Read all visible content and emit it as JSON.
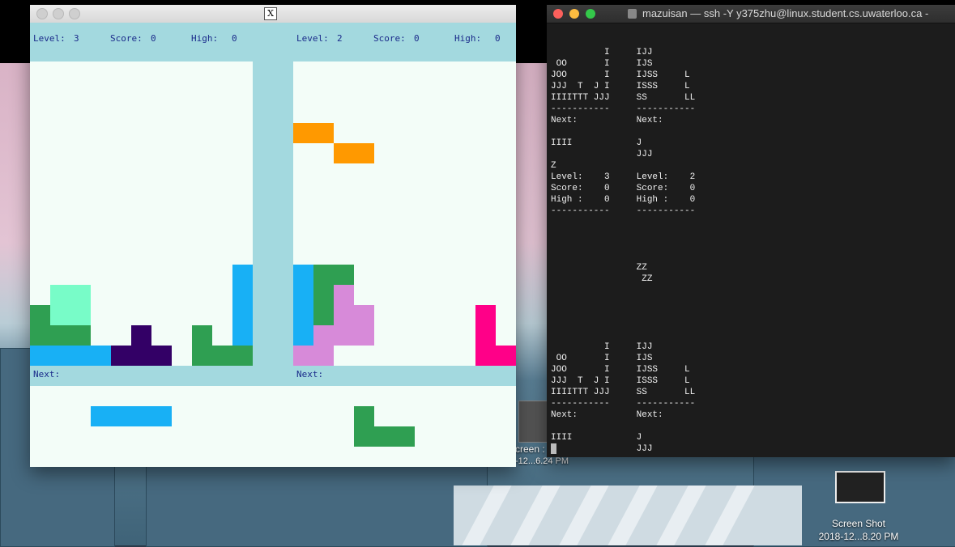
{
  "xwindow": {
    "title_icon": "X",
    "players": [
      {
        "level_label": "Level:",
        "level": "3",
        "score_label": "Score:",
        "score": "0",
        "high_label": "High:",
        "high": "0",
        "next_label": "Next:"
      },
      {
        "level_label": "Level:",
        "level": "2",
        "score_label": "Score:",
        "score": "0",
        "high_label": "High:",
        "high": "0",
        "next_label": "Next:"
      }
    ]
  },
  "terminal": {
    "title": "mazuisan — ssh -Y y375zhu@linux.student.cs.uwaterloo.ca -",
    "lines": [
      "          I     IJJ",
      " OO       I     IJS",
      "JOO       I     IJSS     L",
      "JJJ  T  J I     ISSS     L",
      "IIIITTT JJJ     SS       LL",
      "-----------     -----------",
      "Next:           Next:",
      "",
      "IIII            J",
      "                JJJ",
      "Z",
      "Level:    3     Level:    2",
      "Score:    0     Score:    0",
      "High :    0     High :    0",
      "-----------     -----------",
      "",
      "",
      "",
      "",
      "                ZZ",
      "                 ZZ",
      "",
      "",
      "",
      "",
      "",
      "          I     IJJ",
      " OO       I     IJS",
      "JOO       I     IJSS     L",
      "JJJ  T  J I     ISSS     L",
      "IIIITTT JJJ     SS       LL",
      "-----------     -----------",
      "Next:           Next:",
      "",
      "IIII            J",
      "                JJJ"
    ]
  },
  "desktop": {
    "screenshot_label_1": "Screen Shot",
    "screenshot_date_1": "2018-12...8.20 PM",
    "partial_label_2": "creen :",
    "partial_date_2": "-12...6.24 PM"
  }
}
